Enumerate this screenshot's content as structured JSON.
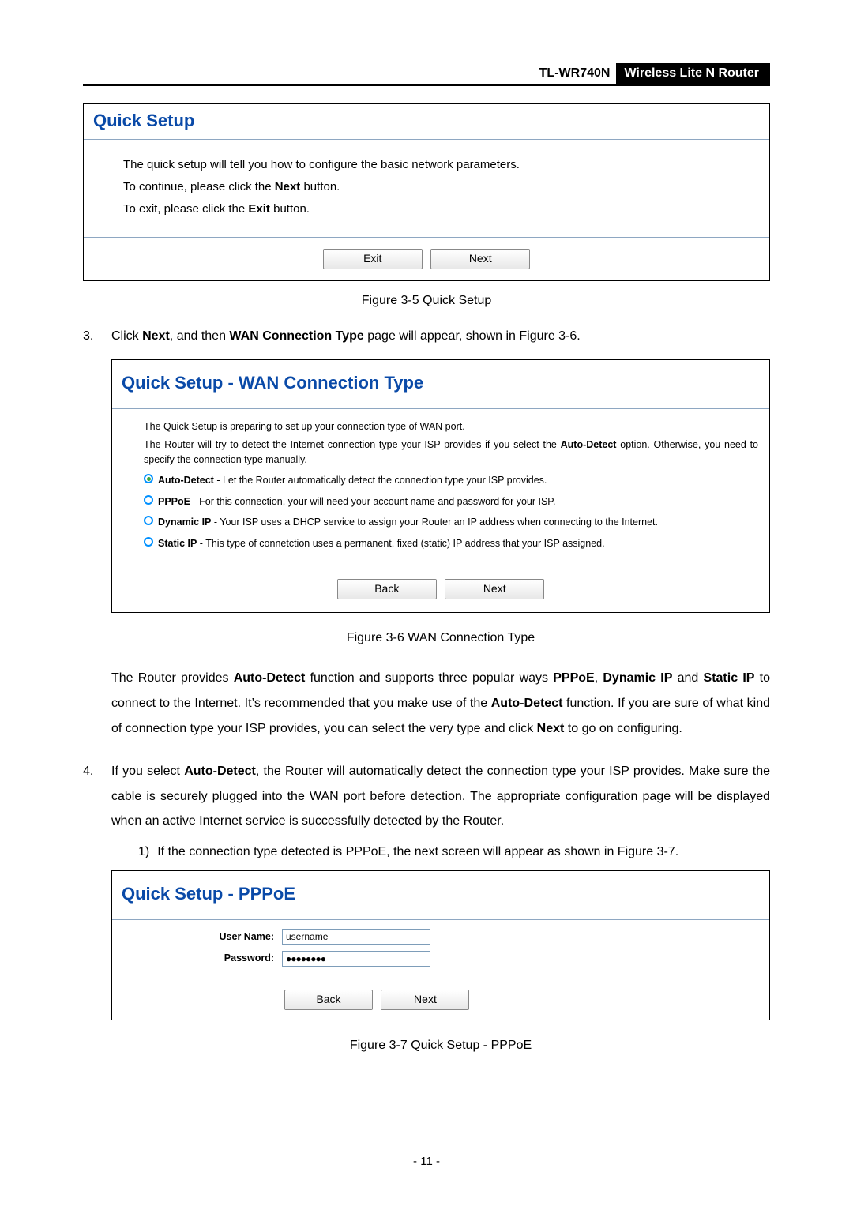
{
  "header": {
    "model": "TL-WR740N",
    "desc": "Wireless  Lite  N  Router"
  },
  "fig5_panel": {
    "title": "Quick Setup",
    "line1": "The quick setup will tell you how to configure the basic network parameters.",
    "line2_pre": "To continue, please click the ",
    "line2_b": "Next",
    "line2_post": " button.",
    "line3_pre": "To exit, please click the ",
    "line3_b": "Exit",
    "line3_post": "  button.",
    "btn_exit": "Exit",
    "btn_next": "Next"
  },
  "fig5_caption": "Figure 3-5    Quick Setup",
  "step3": {
    "num": "3.",
    "t1": "Click ",
    "b1": "Next",
    "t2": ", and then ",
    "b2": "WAN Connection Type",
    "t3": " page will appear, shown in Figure 3-6."
  },
  "fig6_panel": {
    "title": "Quick Setup - WAN Connection Type",
    "p1": "The Quick Setup is preparing to set up your connection type of WAN port.",
    "p2_pre": "The Router will try to detect the Internet connection type your ISP provides if you select the ",
    "p2_b": "Auto-Detect",
    "p2_post": " option. Otherwise, you need to specify the connection type manually.",
    "opt1_b": "Auto-Detect",
    "opt1_t": " - Let the Router automatically detect the connection type your ISP provides.",
    "opt2_b": "PPPoE",
    "opt2_t": " - For this connection, your will need your account name and password for your ISP.",
    "opt3_b": "Dynamic IP",
    "opt3_t": " - Your ISP uses a DHCP service to assign your Router an IP address when connecting to the Internet.",
    "opt4_b": "Static IP",
    "opt4_t": " - This type of connetction uses a permanent, fixed (static) IP address that your ISP assigned.",
    "btn_back": "Back",
    "btn_next": "Next"
  },
  "fig6_caption": "Figure 3-6    WAN Connection Type",
  "para_after6": {
    "t1": "The  Router  provides  ",
    "b1": "Auto-Detect",
    "t2": "  function  and  supports  three  popular  ways  ",
    "b2": "PPPoE",
    "t3": ",  ",
    "b3": "Dynamic IP",
    "t4": " and ",
    "b4": "Static IP",
    "t5": " to connect to the Internet. It’s recommended that you make use of the ",
    "b5": "Auto-Detect",
    "t6": " function. If you are sure of what kind of connection type your ISP provides, you can select the very type and click ",
    "b6": "Next",
    "t7": " to go on configuring."
  },
  "step4": {
    "num": "4.",
    "t1": "If you select ",
    "b1": "Auto-Detect",
    "t2": ", the Router will automatically detect the connection type your ISP provides. Make sure the cable is securely plugged into the WAN port before detection. The appropriate  configuration  page  will  be  displayed  when  an  active  Internet  service  is successfully detected by the Router."
  },
  "step4_sub1": {
    "num": "1)",
    "text": "If the connection type detected is PPPoE, the next screen will appear as shown in Figure 3-7."
  },
  "fig7_panel": {
    "title": "Quick Setup - PPPoE",
    "lbl_user": "User Name:",
    "val_user": "username",
    "lbl_pass": "Password:",
    "val_pass": "●●●●●●●●",
    "btn_back": "Back",
    "btn_next": "Next"
  },
  "fig7_caption": "Figure 3-7    Quick Setup - PPPoE",
  "page_number": "- 11 -"
}
